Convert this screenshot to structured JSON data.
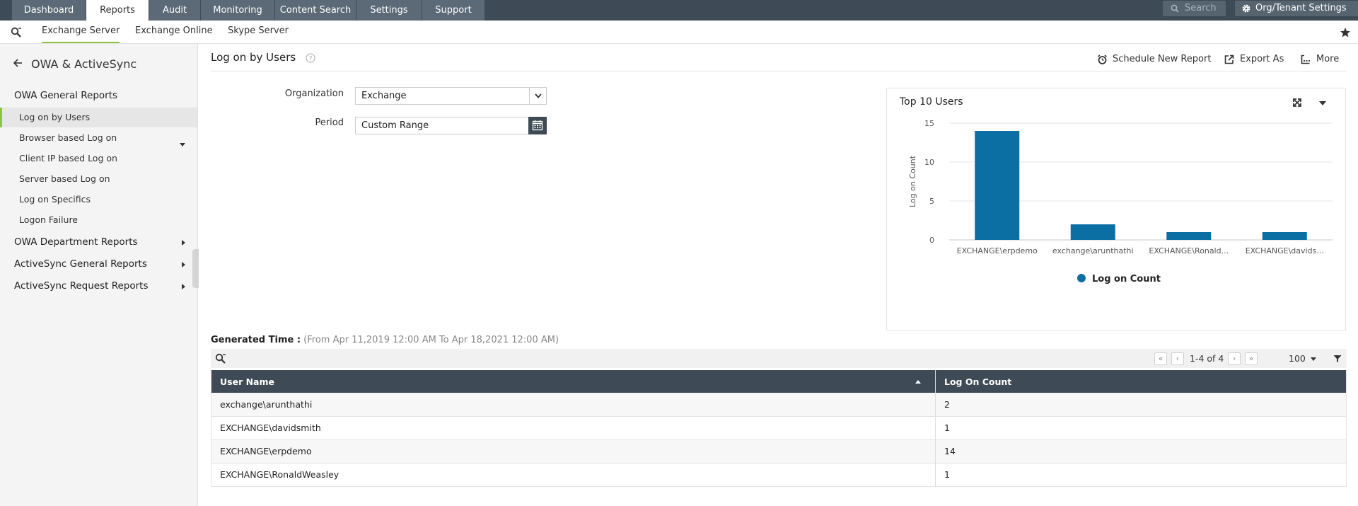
{
  "topnav": {
    "tabs": [
      "Dashboard",
      "Reports",
      "Audit",
      "Monitoring",
      "Content Search",
      "Settings",
      "Support"
    ],
    "active_tab": "Reports",
    "search_placeholder": "Search",
    "org_settings": "Org/Tenant Settings"
  },
  "subnav": {
    "tabs": [
      "Exchange Server",
      "Exchange Online",
      "Skype Server"
    ],
    "active_tab": "Exchange Server"
  },
  "sidebar": {
    "title": "OWA & ActiveSync",
    "groups": [
      {
        "label": "OWA General Reports",
        "expanded": true,
        "items": [
          "Log on by Users",
          "Browser based Log on",
          "Client IP based Log on",
          "Server based Log on",
          "Log on Specifics",
          "Logon Failure"
        ]
      },
      {
        "label": "OWA Department Reports",
        "expanded": false
      },
      {
        "label": "ActiveSync General Reports",
        "expanded": false
      },
      {
        "label": "ActiveSync Request Reports",
        "expanded": false
      }
    ],
    "active_item": "Log on by Users"
  },
  "header": {
    "title": "Log on by Users",
    "actions": {
      "schedule": "Schedule New Report",
      "export": "Export As",
      "more": "More"
    }
  },
  "form": {
    "organization_label": "Organization",
    "organization_value": "Exchange",
    "period_label": "Period",
    "period_value": "Custom Range"
  },
  "panel": {
    "title": "Top 10 Users"
  },
  "chart_data": {
    "type": "bar",
    "categories": [
      "EXCHANGE\\erpdemo",
      "exchange\\arunthathi",
      "EXCHANGE\\Ronald...",
      "EXCHANGE\\davids..."
    ],
    "series": [
      {
        "name": "Log on Count",
        "values": [
          14,
          2,
          1,
          1
        ],
        "color": "#0b6fa4"
      }
    ],
    "ylabel": "Log on Count",
    "ylim": [
      0,
      15
    ],
    "yticks": [
      0,
      5,
      10,
      15
    ],
    "grid": true,
    "legend": "bottom"
  },
  "generated": {
    "label": "Generated Time :",
    "value": "(From Apr 11,2019 12:00 AM To Apr 18,2021 12:00 AM)"
  },
  "pager": {
    "range": "1-4 of 4",
    "page_size": "100"
  },
  "table": {
    "columns": [
      "User Name",
      "Log On Count"
    ],
    "rows": [
      [
        "exchange\\arunthathi",
        "2"
      ],
      [
        "EXCHANGE\\davidsmith",
        "1"
      ],
      [
        "EXCHANGE\\erpdemo",
        "14"
      ],
      [
        "EXCHANGE\\RonaldWeasley",
        "1"
      ]
    ]
  },
  "colors": {
    "nav_bg": "#3e4a55",
    "tab_bg": "#5b6a76",
    "accent_green": "#8cc63f",
    "bar_blue": "#0b6fa4"
  }
}
